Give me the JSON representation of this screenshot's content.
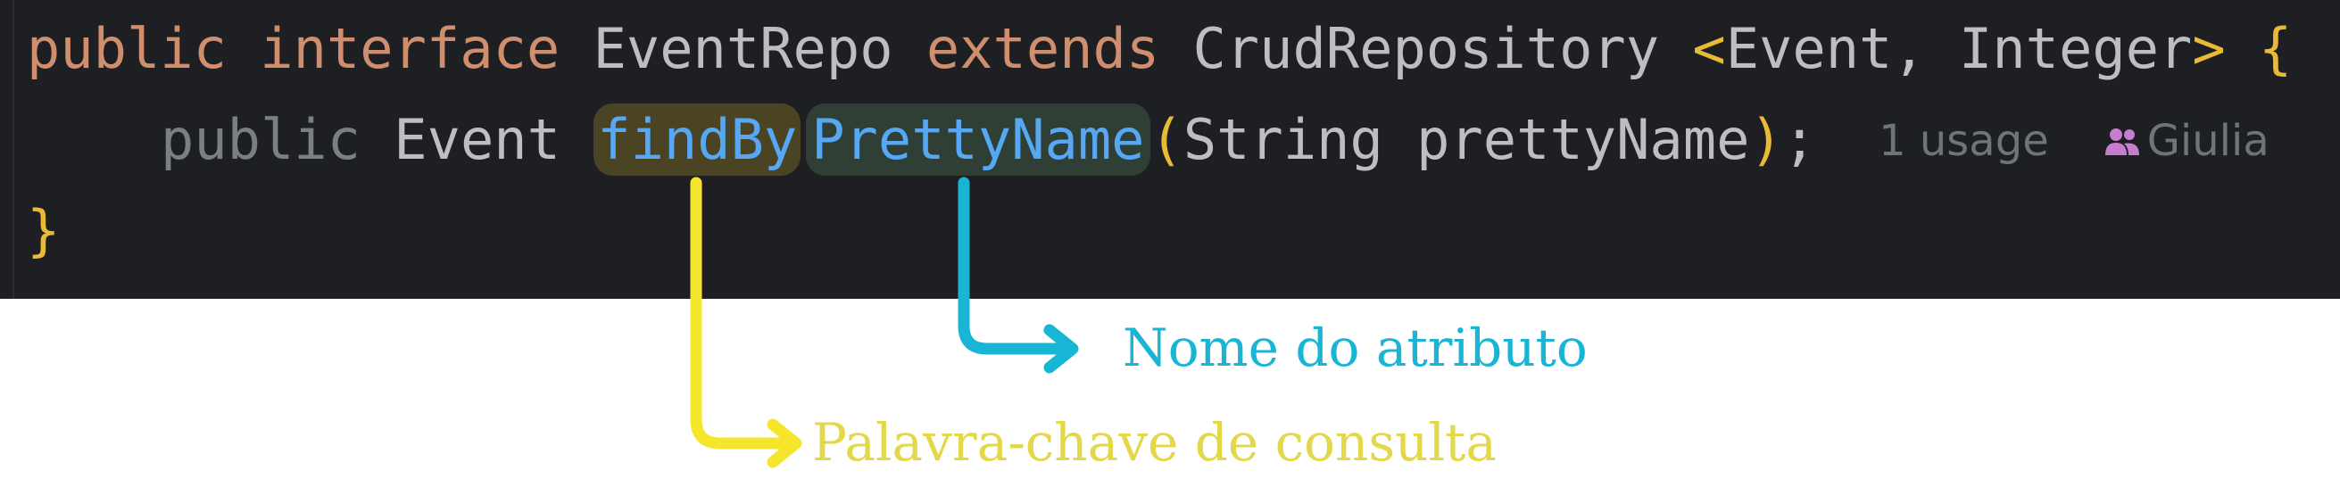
{
  "code": {
    "line1": {
      "public": "public",
      "interface": "interface",
      "name": "EventRepo",
      "extends": "extends",
      "parent": "CrudRepository",
      "lt": "<",
      "type1": "Event",
      "comma": ",",
      "type2": "Integer",
      "gt": ">",
      "brace": "{"
    },
    "line2": {
      "public": "public",
      "return_type": "Event",
      "method_keyword": "findBy",
      "method_attribute": "PrettyName",
      "open_paren": "(",
      "param_type": "String",
      "param_name": "prettyName",
      "close_paren": ")",
      "semicolon": ";",
      "usage_hint": "1 usage",
      "author_hint": "Giulia"
    },
    "line3": {
      "brace": "}"
    }
  },
  "annotations": {
    "attribute_label": "Nome do atributo",
    "keyword_label": "Palavra-chave de consulta"
  },
  "colors": {
    "editor_bg": "#1e1f22",
    "keyword": "#cf8e6d",
    "method": "#56a8f5",
    "bracket": "#e8ba36",
    "attribute_arrow": "#18b6d4",
    "keyword_arrow": "#f5e62b",
    "author_icon": "#c77dcf"
  },
  "icons": {
    "author": "people-icon",
    "attribute_arrow": "arrow-right-icon",
    "keyword_arrow": "arrow-right-icon"
  }
}
